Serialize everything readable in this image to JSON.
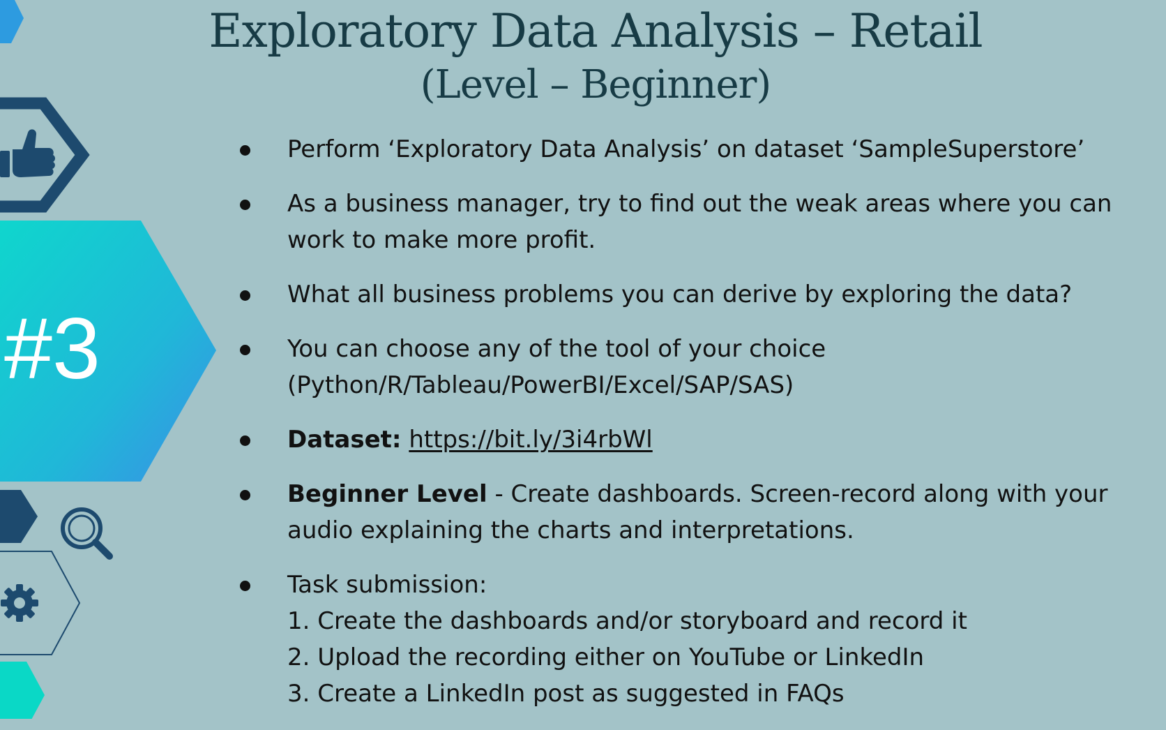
{
  "title": "Exploratory Data Analysis – Retail",
  "subtitle": "(Level – Beginner)",
  "badge": "#3",
  "colors": {
    "background": "#a3c3c8",
    "navy": "#1d4a6e",
    "teal": "#14cfd0",
    "blue": "#2d9be0"
  },
  "icons": [
    "thumbs-up-icon",
    "magnifier-icon",
    "gear-icon"
  ],
  "items": [
    {
      "text": "Perform ‘Exploratory Data Analysis’ on dataset  ‘SampleSuperstore’"
    },
    {
      "line1": "As a business manager, try to find out the weak areas where you can",
      "line2": "work to make more profit."
    },
    {
      "text": "What all business problems you can derive by exploring the  data?"
    },
    {
      "line1": "You can choose any of the tool of your choice",
      "line2": "(Python/R/Tableau/PowerBI/Excel/SAP/SAS)"
    },
    {
      "label": "Dataset:",
      "link": "https://bit.ly/3i4rbWl"
    },
    {
      "label": "Beginner Level",
      "line1": " - Create dashboards. Screen-record along with your",
      "line2": "audio explaining the charts and interpretations."
    },
    {
      "heading": "Task submission:",
      "steps": [
        "1. Create the dashboards and/or storyboard and record it",
        "2. Upload the recording either on YouTube or LinkedIn",
        "3. Create a LinkedIn post as suggested in FAQs"
      ]
    }
  ]
}
